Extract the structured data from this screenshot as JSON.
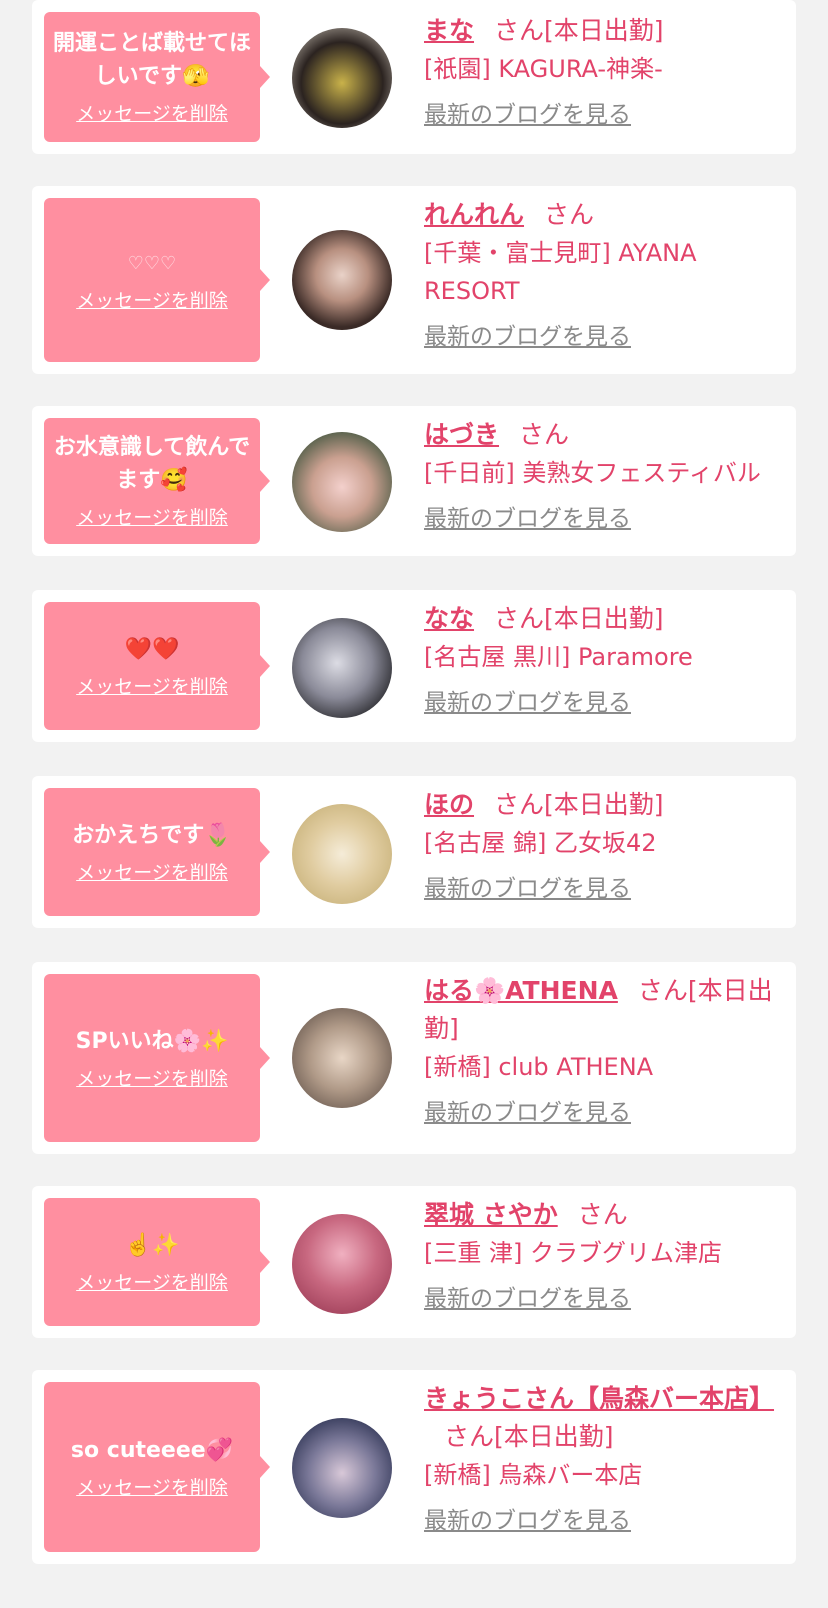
{
  "cards": [
    {
      "message": "開運ことば載せてほしいです🫣",
      "delete_label": "メッセージを削除",
      "name": "まな",
      "honorific": "さん",
      "status": "[本日出勤]",
      "shop": "[祇園] KAGURA-神楽-",
      "blog_label": "最新のブログを見る",
      "avatar_colors": [
        "#2b2320",
        "#c9b24a"
      ]
    },
    {
      "message": "♡♡♡",
      "delete_label": "メッセージを削除",
      "name": "れんれん",
      "honorific": "さん",
      "status": "",
      "shop": "[千葉・富士見町] AYANA RESORT",
      "blog_label": "最新のブログを見る",
      "avatar_colors": [
        "#3a2a26",
        "#e9d2c8"
      ]
    },
    {
      "message": "お水意識して飲んでます🥰",
      "delete_label": "メッセージを削除",
      "name": "はづき",
      "honorific": "さん",
      "status": "",
      "shop": "[千日前] 美熟女フェスティバル",
      "blog_label": "最新のブログを見る",
      "avatar_colors": [
        "#4a5a44",
        "#f3d0cc"
      ]
    },
    {
      "message": "❤️❤️",
      "delete_label": "メッセージを削除",
      "name": "なな",
      "honorific": "さん",
      "status": "[本日出勤]",
      "shop": "[名古屋 黒川] Paramore",
      "blog_label": "最新のブログを見る",
      "avatar_colors": [
        "#2a2a2e",
        "#dcdce4"
      ]
    },
    {
      "message": "おかえちです🌷",
      "delete_label": "メッセージを削除",
      "name": "ほの",
      "honorific": "さん",
      "status": "[本日出勤]",
      "shop": "[名古屋 錦] 乙女坂42",
      "blog_label": "最新のブログを見る",
      "avatar_colors": [
        "#c8b27a",
        "#f5ecd8"
      ]
    },
    {
      "message": "SPいいね🌸✨",
      "delete_label": "メッセージを削除",
      "name": "はる🌸ATHENA",
      "honorific": "さん",
      "status": "[本日出勤]",
      "shop": "[新橋] club ATHENA",
      "blog_label": "最新のブログを見る",
      "avatar_colors": [
        "#6a5a50",
        "#e8d6c6"
      ]
    },
    {
      "message": "☝️✨",
      "delete_label": "メッセージを削除",
      "name": "翠城 さやか",
      "honorific": "さん",
      "status": "",
      "shop": "[三重 津] クラブグリム津店",
      "blog_label": "最新のブログを見る",
      "avatar_colors": [
        "#a0405a",
        "#f0b0c0"
      ]
    },
    {
      "message": "so cuteeee💞",
      "delete_label": "メッセージを削除",
      "name": "きょうこさん【鳥森バー本店】",
      "honorific": "さん",
      "status": "[本日出勤]",
      "shop": "[新橋] 烏森バー本店",
      "blog_label": "最新のブログを見る",
      "avatar_colors": [
        "#2a3050",
        "#d8c8d8"
      ]
    }
  ]
}
